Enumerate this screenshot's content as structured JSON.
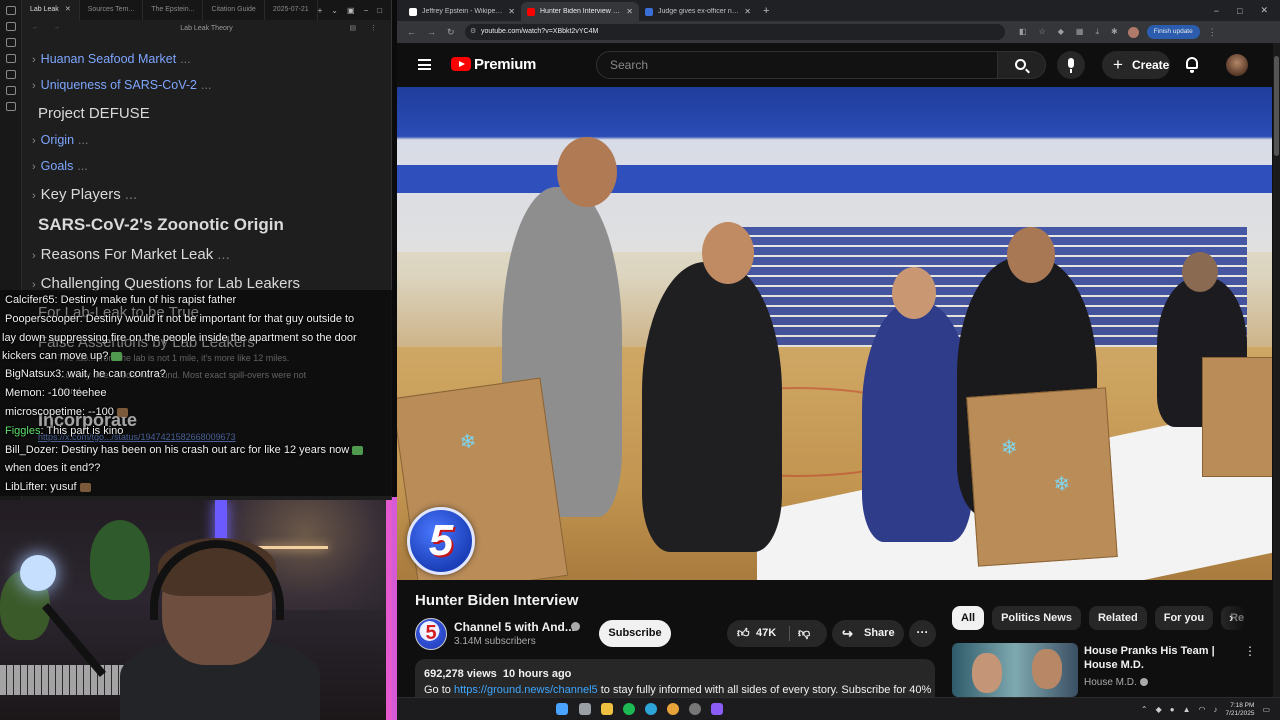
{
  "obsidian": {
    "tabs": [
      "Lab Leak",
      "Sources Tem...",
      "The Epstein...",
      "Citation Guide",
      "2025-07-21"
    ],
    "header_title": "Lab Leak Theory",
    "outline": [
      {
        "text": "Huanan Seafood Market",
        "style": "link"
      },
      {
        "text": "Uniqueness of SARS-CoV-2",
        "style": "link"
      },
      {
        "text": "Project DEFUSE",
        "style": "h3"
      },
      {
        "text": "Origin",
        "style": "link"
      },
      {
        "text": "Goals",
        "style": "link"
      },
      {
        "text": "Key Players",
        "style": "h3c"
      },
      {
        "text": "SARS-CoV-2's Zoonotic Origin",
        "style": "h2"
      },
      {
        "text": "Reasons For Market Leak",
        "style": "h3c"
      },
      {
        "text": "Challenging Questions for Lab Leakers",
        "style": "h3c"
      }
    ],
    "ellipsis": "...",
    "ghost": {
      "lab_leak_true": "For Lab-Leak to be True",
      "false_assertions": "False Assertions by Lab Leakers",
      "lab_distance": "The lab... from the lab is not 1 mile, it's more like 12 miles.",
      "spillover": "...ctively true. ...ects not found. Most exact spill-overs were not",
      "found": "found.",
      "incorporate": "Incorporate",
      "tweet_url": "https://x.com/tgo.../status/1947421582668009673"
    }
  },
  "chat": [
    {
      "user": "Calcifer65",
      "text": "Destiny             make fun of his rapist father",
      "green": false
    },
    {
      "user": "Pooperscooper",
      "text": "Destiny would it not be important for that guy outside to",
      "green": false
    },
    {
      "user": "",
      "text": "lay down suppressing fire on the people inside the apartment so the door",
      "green": false
    },
    {
      "user": "",
      "text": "kickers can move up?",
      "green": false
    },
    {
      "user": "BigNatsux3",
      "text": "wait, he can contra?",
      "green": false
    },
    {
      "user": "Memon",
      "text": "-100 teehee",
      "green": false
    },
    {
      "user": "microscopetime",
      "text": "--100",
      "green": false
    },
    {
      "user": "Figgles",
      "text": "This part is kino",
      "green": true
    },
    {
      "user": "Bill_Dozer",
      "text": "Destiny has been on his crash out arc for like 12 years now",
      "green": false
    },
    {
      "user": "",
      "text": "when does it end??",
      "green": false
    },
    {
      "user": "LibLifter",
      "text": "yusuf",
      "green": false
    }
  ],
  "browser": {
    "tabs": [
      {
        "title": "Jeffrey Epstein - Wikipedia",
        "color": "#ffffff",
        "active": false
      },
      {
        "title": "Hunter Biden Interview - Yo",
        "color": "#ff0000",
        "active": true
      },
      {
        "title": "Judge gives ex-officer nearly 3",
        "color": "#3a6fd8",
        "active": false
      }
    ],
    "url": "youtube.com/watch?v=XBbkt2vYC4M",
    "finish_update": "Finish update"
  },
  "youtube": {
    "brand": "Premium",
    "search_placeholder": "Search",
    "create_label": "Create",
    "video_title": "Hunter Biden Interview",
    "channel_name": "Channel 5 with And...",
    "subscribers": "3.14M subscribers",
    "subscribe_label": "Subscribe",
    "likes": "47K",
    "share_label": "Share",
    "views": "692,278 views",
    "age": "10 hours ago",
    "desc_prefix": "Go to ",
    "desc_link": "https://ground.news/channel5",
    "desc_suffix": " to stay fully informed with all sides of every story. Subscribe for 40%",
    "channel_badge": "5",
    "chips": [
      "All",
      "Politics News",
      "Related",
      "For you",
      "Re"
    ],
    "rec": {
      "title": "House Pranks His Team | House M.D.",
      "channel": "House M.D."
    }
  },
  "taskbar": {
    "time": "7:18 PM",
    "date": "7/21/2025"
  }
}
